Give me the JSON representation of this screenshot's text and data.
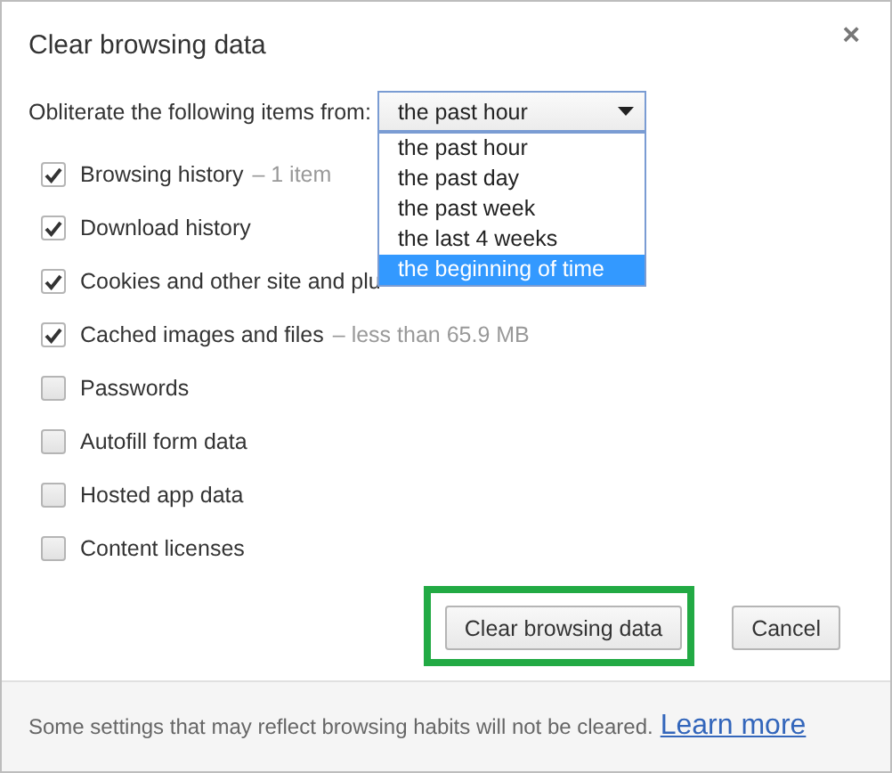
{
  "dialog": {
    "title": "Clear browsing data",
    "close": "×"
  },
  "period": {
    "label": "Obliterate the following items from:",
    "value": "the past hour",
    "options": [
      {
        "label": "the past hour",
        "highlighted": false
      },
      {
        "label": "the past day",
        "highlighted": false
      },
      {
        "label": "the past week",
        "highlighted": false
      },
      {
        "label": "the last 4 weeks",
        "highlighted": false
      },
      {
        "label": "the beginning of time",
        "highlighted": true
      }
    ]
  },
  "items": [
    {
      "label": "Browsing history",
      "detail": "– 1 item",
      "checked": true
    },
    {
      "label": "Download history",
      "checked": true
    },
    {
      "label": "Cookies and other site and plu",
      "checked": true
    },
    {
      "label": "Cached images and files",
      "detail": "– less than 65.9 MB",
      "checked": true
    },
    {
      "label": "Passwords",
      "checked": false
    },
    {
      "label": "Autofill form data",
      "checked": false
    },
    {
      "label": "Hosted app data",
      "checked": false
    },
    {
      "label": "Content licenses",
      "checked": false
    }
  ],
  "buttons": [
    {
      "label": "Clear browsing data",
      "highlighted": true
    },
    {
      "label": "Cancel",
      "highlighted": false
    }
  ],
  "footer": {
    "text": "Some settings that may reflect browsing habits will not be cleared.",
    "link": "Learn more"
  }
}
